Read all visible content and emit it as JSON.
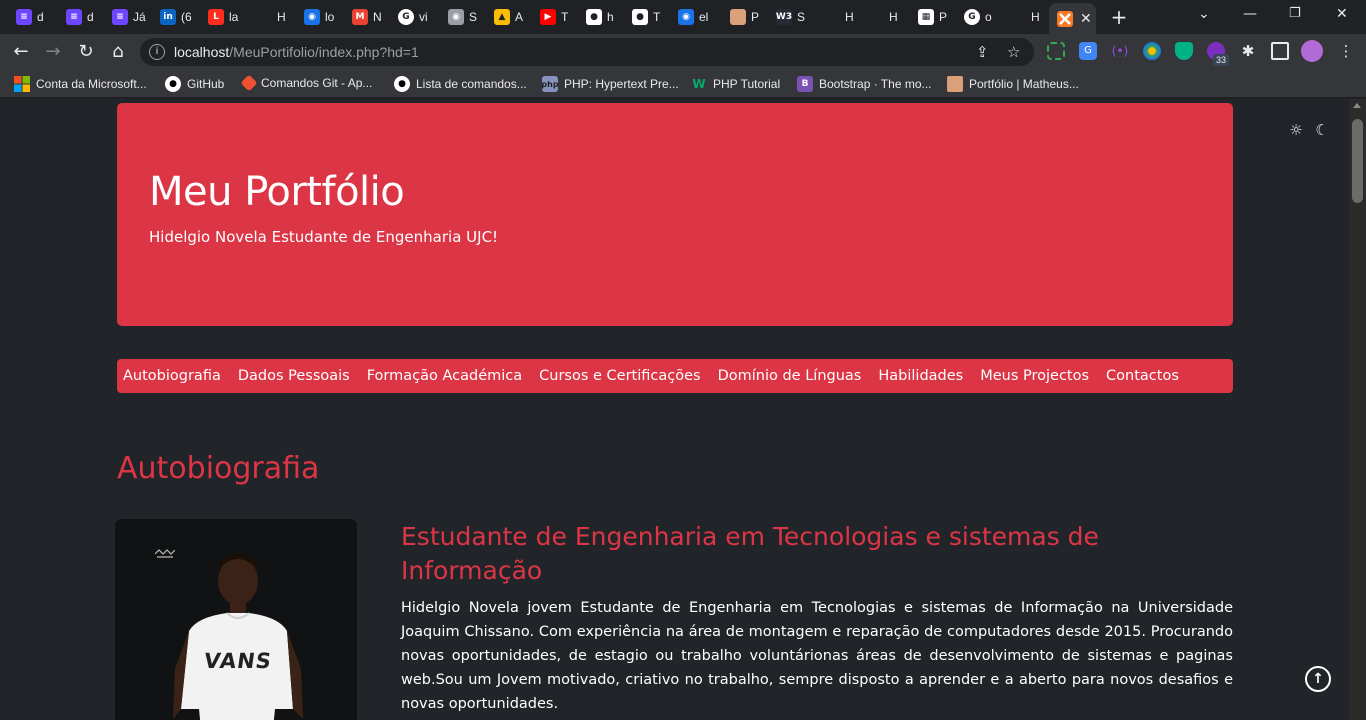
{
  "browser": {
    "tabs": [
      {
        "letter": "d",
        "icon": "list-icon",
        "color": "#6c47ff"
      },
      {
        "letter": "d",
        "icon": "list-icon",
        "color": "#6c47ff"
      },
      {
        "letter": "Já",
        "icon": "list-icon",
        "color": "#6c47ff"
      },
      {
        "letter": "(6",
        "icon": "linkedin-icon",
        "color": "#0a66c2"
      },
      {
        "letter": "la",
        "icon": "laravel-icon",
        "color": "#ff2d20"
      },
      {
        "letter": "H",
        "icon": "blank-icon",
        "color": "#202124"
      },
      {
        "letter": "lo",
        "icon": "globe-icon",
        "color": "#1a73e8"
      },
      {
        "letter": "N",
        "icon": "gmail-icon",
        "color": "#ea4335"
      },
      {
        "letter": "vi",
        "icon": "google-icon",
        "color": "#ffffff"
      },
      {
        "letter": "S",
        "icon": "globe-icon",
        "color": "#9aa0a6"
      },
      {
        "letter": "A",
        "icon": "drive-icon",
        "color": "#fbbc04"
      },
      {
        "letter": "T",
        "icon": "youtube-icon",
        "color": "#ff0000"
      },
      {
        "letter": "h",
        "icon": "github-icon",
        "color": "#ffffff"
      },
      {
        "letter": "T",
        "icon": "github-icon",
        "color": "#ffffff"
      },
      {
        "letter": "el",
        "icon": "globe-icon",
        "color": "#1a73e8"
      },
      {
        "letter": "P",
        "icon": "avatar-icon",
        "color": "#d9a07a"
      },
      {
        "letter": "S",
        "icon": "w3schools-icon",
        "color": "#282a35"
      },
      {
        "letter": "H",
        "icon": "blank-icon",
        "color": "#202124"
      },
      {
        "letter": "H",
        "icon": "blank-icon",
        "color": "#202124"
      },
      {
        "letter": "P",
        "icon": "grid-icon",
        "color": "#ffffff"
      },
      {
        "letter": "o",
        "icon": "google-icon",
        "color": "#ffffff"
      },
      {
        "letter": "H",
        "icon": "blank-icon",
        "color": "#202124"
      }
    ],
    "active_tab_icon": "xampp-icon",
    "url_host": "localhost",
    "url_path": "/MeuPortifolio/index.php?hd=1",
    "extension_badge": "33",
    "bookmarks": [
      {
        "label": "Conta da Microsoft...",
        "icon": "microsoft-icon"
      },
      {
        "label": "GitHub",
        "icon": "github-icon"
      },
      {
        "label": "Comandos Git - Ap...",
        "icon": "git-icon"
      },
      {
        "label": "Lista de comandos...",
        "icon": "github-icon"
      },
      {
        "label": "PHP: Hypertext Pre...",
        "icon": "php-icon"
      },
      {
        "label": "PHP Tutorial",
        "icon": "w-icon"
      },
      {
        "label": "Bootstrap · The mo...",
        "icon": "bootstrap-icon"
      },
      {
        "label": "Portfólio | Matheus...",
        "icon": "avatar-icon"
      }
    ]
  },
  "page": {
    "hero": {
      "title": "Meu Portfólio",
      "subtitle": "Hidelgio Novela Estudante de Engenharia UJC!"
    },
    "nav": [
      "Autobiografia",
      "Dados Pessoais",
      "Formação Académica",
      "Cursos e Certificações",
      "Domínio de Línguas",
      "Habilidades",
      "Meus Projectos",
      "Contactos"
    ],
    "section_title": "Autobiografia",
    "bio_heading": "Estudante de Engenharia em Tecnologias e sistemas de Informação",
    "bio_text": "Hidelgio Novela jovem Estudante de Engenharia em Tecnologias e sistemas de Informação na Universidade Joaquim Chissano. Com experiência na área de montagem e reparação de computadores desde 2015. Procurando novas oportunidades, de estagio ou trabalho voluntárionas áreas de desenvolvimento de sistemas e paginas web.Sou um Jovem motivado, criativo no trabalho, sempre disposto a aprender e a aberto para novos desafios e novas oportunidades.",
    "shirt_text": "VANS",
    "accent_color": "#dc3545"
  }
}
